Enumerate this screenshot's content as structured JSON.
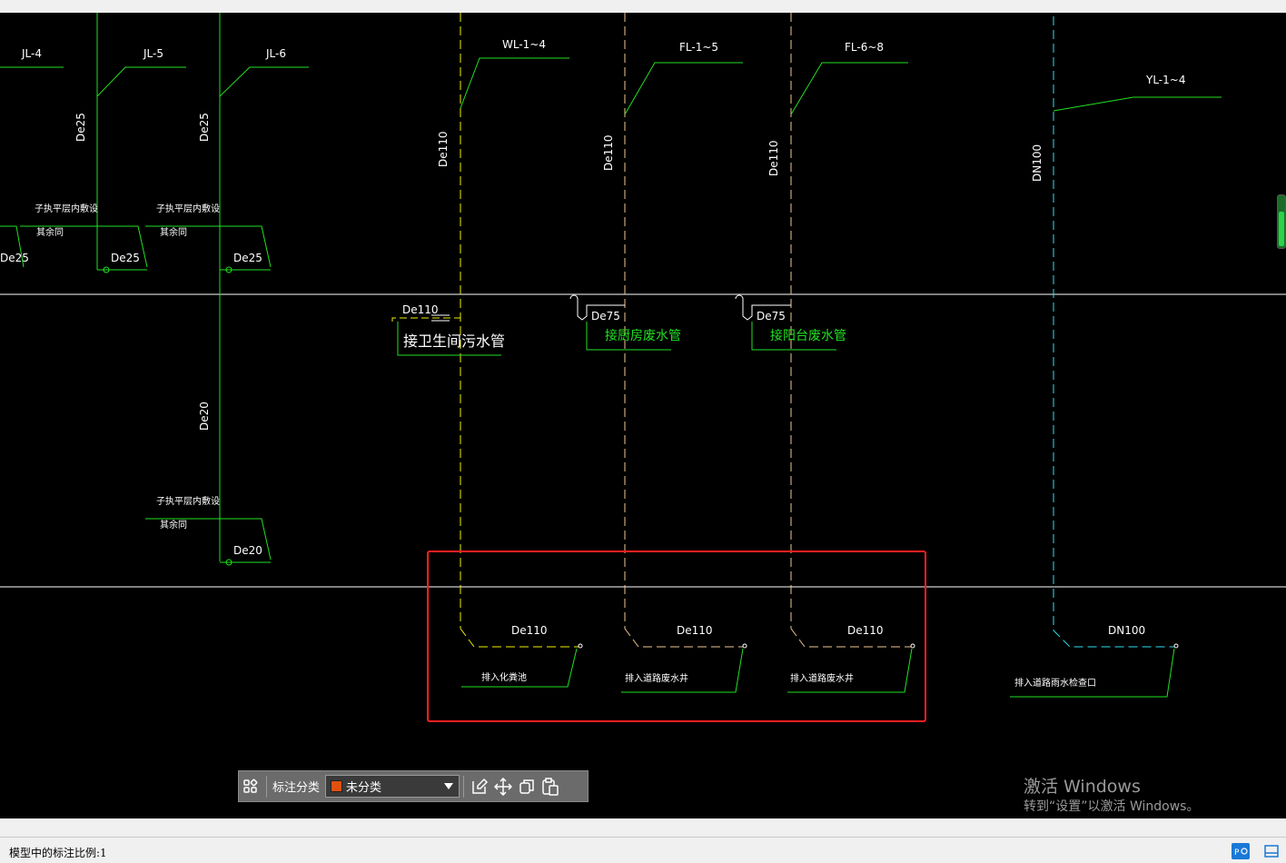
{
  "drawing": {
    "risers": [
      {
        "id": "JL-4",
        "label": "JL-4"
      },
      {
        "id": "JL-5",
        "label": "JL-5"
      },
      {
        "id": "JL-6",
        "label": "JL-6"
      },
      {
        "id": "WL",
        "label": "WL-1~4"
      },
      {
        "id": "FL1",
        "label": "FL-1~5"
      },
      {
        "id": "FL6",
        "label": "FL-6~8"
      },
      {
        "id": "YL",
        "label": "YL-1~4"
      }
    ],
    "pipe_sizes": {
      "de25": "De25",
      "de20": "De20",
      "de110": "De110",
      "de75": "De75",
      "dn100": "DN100"
    },
    "notes": {
      "branch_note_1": "子执平层内敷设",
      "branch_note_2": "其余同",
      "wl_inlet": "接卫生间污水管",
      "fl1_inlet": "接厨房废水管",
      "fl6_inlet": "接阳台废水管",
      "wl_outlet": "排入化粪池",
      "fl1_outlet": "排入道路废水井",
      "fl6_outlet": "排入道路废水井",
      "yl_outlet": "排入道路雨水检查口"
    },
    "colors": {
      "background": "#000000",
      "supply_pipe": "#22e022",
      "waste_pipe": "#f0f000",
      "drain_pipe": "#f0c890",
      "rain_pipe": "#30e0f0",
      "highlight_box": "#ff2020"
    }
  },
  "toolbar": {
    "layout_icon": "grid-layout-icon",
    "label": "标注分类",
    "category_value": "未分类",
    "category_color": "#e05010",
    "edit_icon": "edit-icon",
    "move_icon": "move-icon",
    "copy_icon": "copy-icon",
    "paste_icon": "paste-icon"
  },
  "watermark": {
    "title": "激活 Windows",
    "subtitle": "转到“设置”以激活 Windows。"
  },
  "statusbar": {
    "scale_text": "模型中的标注比例:1"
  }
}
